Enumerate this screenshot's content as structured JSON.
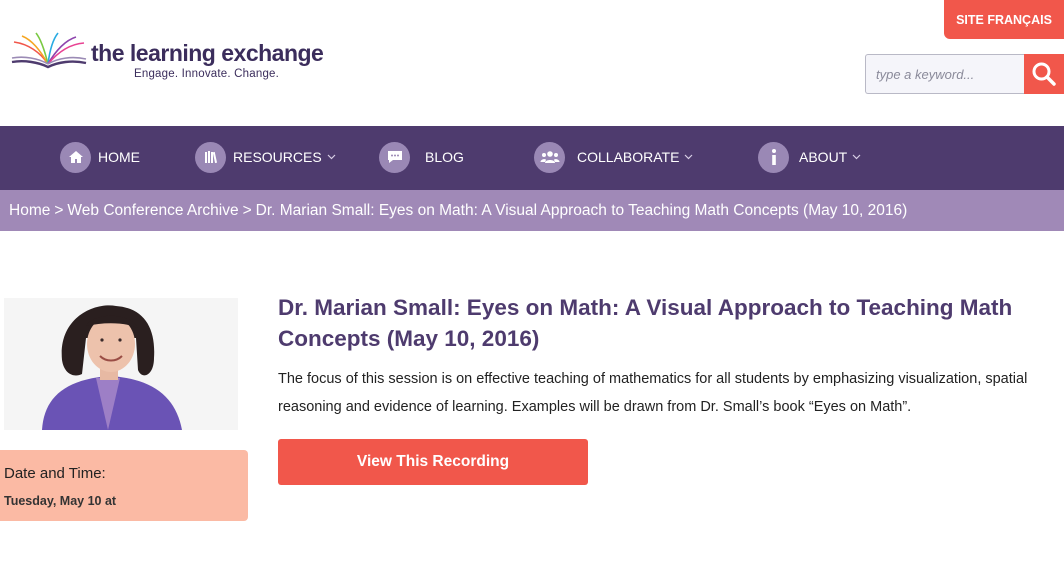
{
  "header": {
    "logo_title": "the learning exchange",
    "logo_tagline": "Engage. Innovate. Change.",
    "site_language_button": "SITE FRANÇAIS",
    "search": {
      "placeholder": "type a keyword...",
      "icon": "search-icon"
    }
  },
  "nav": {
    "items": [
      {
        "label": "HOME",
        "icon": "home-icon",
        "has_dropdown": false
      },
      {
        "label": "RESOURCES",
        "icon": "books-icon",
        "has_dropdown": true
      },
      {
        "label": "BLOG",
        "icon": "chat-bubble-icon",
        "has_dropdown": false
      },
      {
        "label": "COLLABORATE",
        "icon": "people-icon",
        "has_dropdown": true
      },
      {
        "label": "ABOUT",
        "icon": "info-icon",
        "has_dropdown": true
      }
    ]
  },
  "breadcrumb": {
    "items": [
      "Home",
      "Web Conference Archive",
      "Dr. Marian Small: Eyes on Math: A Visual Approach to Teaching Math Concepts (May 10, 2016)"
    ],
    "separator": ">"
  },
  "event": {
    "title": "Dr. Marian Small: Eyes on Math: A Visual Approach to Teaching Math Concepts (May 10, 2016)",
    "description": "The focus of this session is on effective teaching of mathematics for all students by emphasizing visualization, spatial reasoning and evidence of learning. Examples will be drawn from Dr. Small’s book “Eyes on Math”.",
    "date_label": "Date and Time:",
    "date_value": "Tuesday, May 10 at",
    "cta_label": "View This Recording"
  },
  "colors": {
    "primary_purple": "#4e3b6e",
    "breadcrumb_purple": "#a089b7",
    "accent_coral": "#f1574b",
    "date_box": "#fbbaa4"
  }
}
